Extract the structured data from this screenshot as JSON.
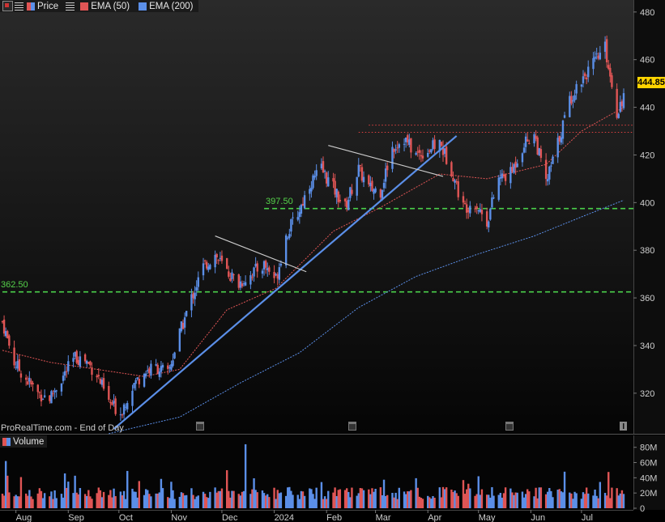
{
  "legend": {
    "price_label": "Price",
    "ema50_label": "EMA (50)",
    "ema200_label": "EMA (200)"
  },
  "volume_legend": {
    "label": "Volume"
  },
  "watermark": "ProRealTime.com - End of Day",
  "last_price": "444.85",
  "colors": {
    "up": "#5b8fe8",
    "down": "#e05555",
    "ema50": "#e05555",
    "ema200": "#5b8fe8",
    "trend": "#5b8fe8",
    "wedge": "#cccccc",
    "support": "#4ad04a",
    "resistance": "#e04040",
    "price_tag": "#ffd400"
  },
  "chart_data": [
    {
      "type": "candlestick",
      "title": "",
      "x_ticks": [
        "Aug",
        "Sep",
        "Oct",
        "Nov",
        "Dec",
        "2024",
        "Feb",
        "Mar",
        "Apr",
        "May",
        "Jun",
        "Jul"
      ],
      "y_ticks": [
        320,
        340,
        360,
        380,
        400,
        420,
        440,
        460,
        480
      ],
      "ylim": [
        305,
        483
      ],
      "period": {
        "start": "2023-07-24",
        "end": "2024-07-26"
      },
      "series": [
        {
          "name": "Price",
          "type": "candlestick",
          "approx_close_path": [
            {
              "x": "2023-07-24",
              "y": 350
            },
            {
              "x": "2023-07-31",
              "y": 333
            },
            {
              "x": "2023-08-07",
              "y": 326
            },
            {
              "x": "2023-08-14",
              "y": 320
            },
            {
              "x": "2023-08-21",
              "y": 318
            },
            {
              "x": "2023-08-28",
              "y": 326
            },
            {
              "x": "2023-09-05",
              "y": 335
            },
            {
              "x": "2023-09-11",
              "y": 334
            },
            {
              "x": "2023-09-18",
              "y": 328
            },
            {
              "x": "2023-09-25",
              "y": 316
            },
            {
              "x": "2023-10-02",
              "y": 312
            },
            {
              "x": "2023-10-09",
              "y": 323
            },
            {
              "x": "2023-10-16",
              "y": 329
            },
            {
              "x": "2023-10-23",
              "y": 331
            },
            {
              "x": "2023-10-30",
              "y": 328
            },
            {
              "x": "2023-11-06",
              "y": 345
            },
            {
              "x": "2023-11-13",
              "y": 360
            },
            {
              "x": "2023-11-20",
              "y": 373
            },
            {
              "x": "2023-11-27",
              "y": 378
            },
            {
              "x": "2023-12-04",
              "y": 371
            },
            {
              "x": "2023-12-11",
              "y": 366
            },
            {
              "x": "2023-12-18",
              "y": 370
            },
            {
              "x": "2023-12-26",
              "y": 374
            },
            {
              "x": "2024-01-02",
              "y": 368
            },
            {
              "x": "2024-01-08",
              "y": 386
            },
            {
              "x": "2024-01-16",
              "y": 397
            },
            {
              "x": "2024-01-22",
              "y": 408
            },
            {
              "x": "2024-01-29",
              "y": 414
            },
            {
              "x": "2024-02-05",
              "y": 406
            },
            {
              "x": "2024-02-12",
              "y": 398
            },
            {
              "x": "2024-02-20",
              "y": 414
            },
            {
              "x": "2024-02-26",
              "y": 406
            },
            {
              "x": "2024-03-04",
              "y": 405
            },
            {
              "x": "2024-03-11",
              "y": 423
            },
            {
              "x": "2024-03-18",
              "y": 427
            },
            {
              "x": "2024-03-25",
              "y": 420
            },
            {
              "x": "2024-04-01",
              "y": 422
            },
            {
              "x": "2024-04-08",
              "y": 425
            },
            {
              "x": "2024-04-15",
              "y": 414
            },
            {
              "x": "2024-04-22",
              "y": 398
            },
            {
              "x": "2024-04-29",
              "y": 400
            },
            {
              "x": "2024-05-06",
              "y": 392
            },
            {
              "x": "2024-05-13",
              "y": 410
            },
            {
              "x": "2024-05-20",
              "y": 412
            },
            {
              "x": "2024-05-28",
              "y": 425
            },
            {
              "x": "2024-06-03",
              "y": 429
            },
            {
              "x": "2024-06-10",
              "y": 408
            },
            {
              "x": "2024-06-17",
              "y": 425
            },
            {
              "x": "2024-06-24",
              "y": 443
            },
            {
              "x": "2024-07-01",
              "y": 452
            },
            {
              "x": "2024-07-08",
              "y": 458
            },
            {
              "x": "2024-07-15",
              "y": 465
            },
            {
              "x": "2024-07-22",
              "y": 438
            },
            {
              "x": "2024-07-26",
              "y": 444.85
            }
          ]
        },
        {
          "name": "EMA (50)",
          "type": "line",
          "points": [
            {
              "x": "2023-07-24",
              "y": 338
            },
            {
              "x": "2023-08-21",
              "y": 333
            },
            {
              "x": "2023-09-18",
              "y": 330
            },
            {
              "x": "2023-10-16",
              "y": 327
            },
            {
              "x": "2023-11-06",
              "y": 330
            },
            {
              "x": "2023-12-04",
              "y": 355
            },
            {
              "x": "2024-01-02",
              "y": 364
            },
            {
              "x": "2024-02-05",
              "y": 388
            },
            {
              "x": "2024-03-04",
              "y": 398
            },
            {
              "x": "2024-04-08",
              "y": 412
            },
            {
              "x": "2024-05-06",
              "y": 410
            },
            {
              "x": "2024-06-10",
              "y": 416
            },
            {
              "x": "2024-07-01",
              "y": 430
            },
            {
              "x": "2024-07-26",
              "y": 440
            }
          ]
        },
        {
          "name": "EMA (200)",
          "type": "line",
          "points": [
            {
              "x": "2023-09-25",
              "y": 303
            },
            {
              "x": "2023-11-06",
              "y": 310
            },
            {
              "x": "2023-12-11",
              "y": 324
            },
            {
              "x": "2024-01-16",
              "y": 337
            },
            {
              "x": "2024-02-20",
              "y": 356
            },
            {
              "x": "2024-03-25",
              "y": 369
            },
            {
              "x": "2024-04-29",
              "y": 378
            },
            {
              "x": "2024-06-03",
              "y": 386
            },
            {
              "x": "2024-07-01",
              "y": 394
            },
            {
              "x": "2024-07-26",
              "y": 401
            }
          ]
        }
      ],
      "horizontal_levels": [
        {
          "label": "397.50",
          "y": 397.5,
          "style": "dashed",
          "color": "#4ad04a",
          "from": "2023-12-26"
        },
        {
          "label": "362.50",
          "y": 362.5,
          "style": "dashed",
          "color": "#4ad04a",
          "from": "2023-07-24"
        },
        {
          "y": 432.5,
          "style": "dotted",
          "color": "#e04040",
          "from": "2024-02-26"
        },
        {
          "y": 429.5,
          "style": "dotted",
          "color": "#e04040",
          "from": "2024-02-20"
        }
      ],
      "trendlines": [
        {
          "kind": "support",
          "from": {
            "x": "2023-09-28",
            "y": 305
          },
          "to": {
            "x": "2024-04-18",
            "y": 428
          }
        },
        {
          "kind": "wedge",
          "from": {
            "x": "2023-11-27",
            "y": 386
          },
          "to": {
            "x": "2024-01-20",
            "y": 371
          }
        },
        {
          "kind": "wedge",
          "from": {
            "x": "2024-02-02",
            "y": 424
          },
          "to": {
            "x": "2024-04-10",
            "y": 411
          }
        }
      ],
      "legend_position": "top-left",
      "grid": false
    },
    {
      "type": "bar",
      "title": "",
      "y_ticks": [
        "0",
        "20M",
        "40M",
        "60M",
        "80M"
      ],
      "ylim": [
        0,
        85
      ],
      "series": [
        {
          "name": "Volume"
        }
      ],
      "notable_peaks": [
        {
          "x": "2023-07-26",
          "value": 62
        },
        {
          "x": "2023-12-15",
          "value": 88
        },
        {
          "x": "2024-06-21",
          "value": 48
        },
        {
          "x": "2024-05-01",
          "value": 42
        }
      ]
    }
  ]
}
